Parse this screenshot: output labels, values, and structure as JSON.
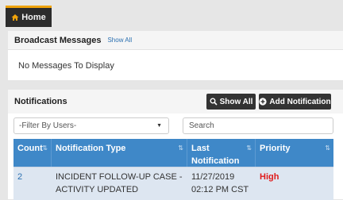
{
  "nav": {
    "home_tab_label": "Home",
    "home_icon": "home-icon",
    "accent_color": "#f0a30a"
  },
  "broadcast": {
    "title": "Broadcast Messages",
    "show_all_link": "Show All",
    "empty_message": "No Messages To Display"
  },
  "notifications": {
    "title": "Notifications",
    "show_all_button": "Show All",
    "add_button": "Add Notification",
    "filter_select_value": "-Filter By Users-",
    "search_placeholder": "Search",
    "columns": [
      "Count",
      "Notification Type",
      "Last Notification",
      "Priority"
    ],
    "rows": [
      {
        "count": "2",
        "type": "INCIDENT FOLLOW-UP CASE - ACTIVITY UPDATED",
        "last": "11/27/2019 02:12 PM CST",
        "priority": "High"
      }
    ],
    "priority_color": "#e01b1b",
    "header_color": "#3f88c8"
  }
}
